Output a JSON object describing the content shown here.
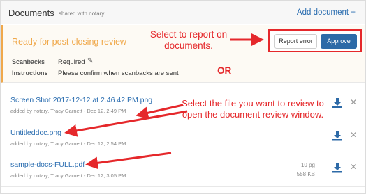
{
  "header": {
    "title": "Documents",
    "shared": "shared with notary",
    "add_label": "Add document +"
  },
  "review": {
    "status": "Ready for post-closing review",
    "scanbacks_label": "Scanbacks",
    "scanbacks_value": "Required",
    "instructions_label": "Instructions",
    "instructions_value": "Please confirm when scanbacks are sent",
    "report_label": "Report error",
    "approve_label": "Approve"
  },
  "annotations": {
    "top": "Select to report on documents.",
    "or": "OR",
    "files": "Select the file you want to review to open the document review window."
  },
  "files": [
    {
      "name": "Screen Shot 2017-12-12 at 2.46.42 PM.png",
      "meta": "added by notary, Tracy Garnett - Dec 12, 2:49 PM"
    },
    {
      "name": "Untitleddoc.png",
      "meta": "added by notary, Tracy Garnett - Dec 12, 2:54 PM"
    },
    {
      "name": "sample-docs-FULL.pdf",
      "meta": "added by notary, Tracy Garnett - Dec 12, 3:05 PM",
      "pages": "10 pg",
      "size": "558 KB"
    }
  ],
  "colors": {
    "accent": "#2d6aa7",
    "status": "#f0a84a",
    "annotation": "#e5282b"
  },
  "icons": {
    "download": "download-icon",
    "remove": "close-icon",
    "edit": "pencil-icon"
  }
}
